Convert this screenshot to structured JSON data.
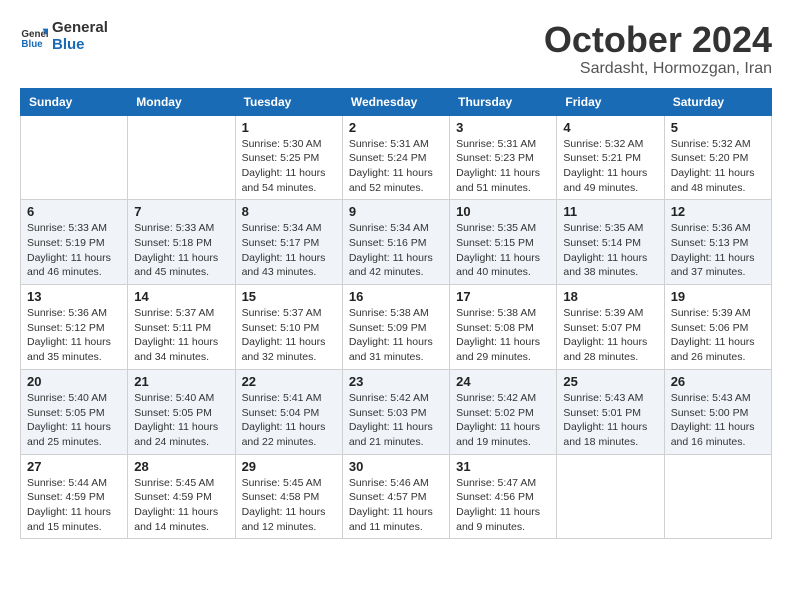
{
  "header": {
    "logo_line1": "General",
    "logo_line2": "Blue",
    "month": "October 2024",
    "location": "Sardasht, Hormozgan, Iran"
  },
  "weekdays": [
    "Sunday",
    "Monday",
    "Tuesday",
    "Wednesday",
    "Thursday",
    "Friday",
    "Saturday"
  ],
  "weeks": [
    [
      {
        "day": "",
        "sunrise": "",
        "sunset": "",
        "daylight": ""
      },
      {
        "day": "",
        "sunrise": "",
        "sunset": "",
        "daylight": ""
      },
      {
        "day": "1",
        "sunrise": "Sunrise: 5:30 AM",
        "sunset": "Sunset: 5:25 PM",
        "daylight": "Daylight: 11 hours and 54 minutes."
      },
      {
        "day": "2",
        "sunrise": "Sunrise: 5:31 AM",
        "sunset": "Sunset: 5:24 PM",
        "daylight": "Daylight: 11 hours and 52 minutes."
      },
      {
        "day": "3",
        "sunrise": "Sunrise: 5:31 AM",
        "sunset": "Sunset: 5:23 PM",
        "daylight": "Daylight: 11 hours and 51 minutes."
      },
      {
        "day": "4",
        "sunrise": "Sunrise: 5:32 AM",
        "sunset": "Sunset: 5:21 PM",
        "daylight": "Daylight: 11 hours and 49 minutes."
      },
      {
        "day": "5",
        "sunrise": "Sunrise: 5:32 AM",
        "sunset": "Sunset: 5:20 PM",
        "daylight": "Daylight: 11 hours and 48 minutes."
      }
    ],
    [
      {
        "day": "6",
        "sunrise": "Sunrise: 5:33 AM",
        "sunset": "Sunset: 5:19 PM",
        "daylight": "Daylight: 11 hours and 46 minutes."
      },
      {
        "day": "7",
        "sunrise": "Sunrise: 5:33 AM",
        "sunset": "Sunset: 5:18 PM",
        "daylight": "Daylight: 11 hours and 45 minutes."
      },
      {
        "day": "8",
        "sunrise": "Sunrise: 5:34 AM",
        "sunset": "Sunset: 5:17 PM",
        "daylight": "Daylight: 11 hours and 43 minutes."
      },
      {
        "day": "9",
        "sunrise": "Sunrise: 5:34 AM",
        "sunset": "Sunset: 5:16 PM",
        "daylight": "Daylight: 11 hours and 42 minutes."
      },
      {
        "day": "10",
        "sunrise": "Sunrise: 5:35 AM",
        "sunset": "Sunset: 5:15 PM",
        "daylight": "Daylight: 11 hours and 40 minutes."
      },
      {
        "day": "11",
        "sunrise": "Sunrise: 5:35 AM",
        "sunset": "Sunset: 5:14 PM",
        "daylight": "Daylight: 11 hours and 38 minutes."
      },
      {
        "day": "12",
        "sunrise": "Sunrise: 5:36 AM",
        "sunset": "Sunset: 5:13 PM",
        "daylight": "Daylight: 11 hours and 37 minutes."
      }
    ],
    [
      {
        "day": "13",
        "sunrise": "Sunrise: 5:36 AM",
        "sunset": "Sunset: 5:12 PM",
        "daylight": "Daylight: 11 hours and 35 minutes."
      },
      {
        "day": "14",
        "sunrise": "Sunrise: 5:37 AM",
        "sunset": "Sunset: 5:11 PM",
        "daylight": "Daylight: 11 hours and 34 minutes."
      },
      {
        "day": "15",
        "sunrise": "Sunrise: 5:37 AM",
        "sunset": "Sunset: 5:10 PM",
        "daylight": "Daylight: 11 hours and 32 minutes."
      },
      {
        "day": "16",
        "sunrise": "Sunrise: 5:38 AM",
        "sunset": "Sunset: 5:09 PM",
        "daylight": "Daylight: 11 hours and 31 minutes."
      },
      {
        "day": "17",
        "sunrise": "Sunrise: 5:38 AM",
        "sunset": "Sunset: 5:08 PM",
        "daylight": "Daylight: 11 hours and 29 minutes."
      },
      {
        "day": "18",
        "sunrise": "Sunrise: 5:39 AM",
        "sunset": "Sunset: 5:07 PM",
        "daylight": "Daylight: 11 hours and 28 minutes."
      },
      {
        "day": "19",
        "sunrise": "Sunrise: 5:39 AM",
        "sunset": "Sunset: 5:06 PM",
        "daylight": "Daylight: 11 hours and 26 minutes."
      }
    ],
    [
      {
        "day": "20",
        "sunrise": "Sunrise: 5:40 AM",
        "sunset": "Sunset: 5:05 PM",
        "daylight": "Daylight: 11 hours and 25 minutes."
      },
      {
        "day": "21",
        "sunrise": "Sunrise: 5:40 AM",
        "sunset": "Sunset: 5:05 PM",
        "daylight": "Daylight: 11 hours and 24 minutes."
      },
      {
        "day": "22",
        "sunrise": "Sunrise: 5:41 AM",
        "sunset": "Sunset: 5:04 PM",
        "daylight": "Daylight: 11 hours and 22 minutes."
      },
      {
        "day": "23",
        "sunrise": "Sunrise: 5:42 AM",
        "sunset": "Sunset: 5:03 PM",
        "daylight": "Daylight: 11 hours and 21 minutes."
      },
      {
        "day": "24",
        "sunrise": "Sunrise: 5:42 AM",
        "sunset": "Sunset: 5:02 PM",
        "daylight": "Daylight: 11 hours and 19 minutes."
      },
      {
        "day": "25",
        "sunrise": "Sunrise: 5:43 AM",
        "sunset": "Sunset: 5:01 PM",
        "daylight": "Daylight: 11 hours and 18 minutes."
      },
      {
        "day": "26",
        "sunrise": "Sunrise: 5:43 AM",
        "sunset": "Sunset: 5:00 PM",
        "daylight": "Daylight: 11 hours and 16 minutes."
      }
    ],
    [
      {
        "day": "27",
        "sunrise": "Sunrise: 5:44 AM",
        "sunset": "Sunset: 4:59 PM",
        "daylight": "Daylight: 11 hours and 15 minutes."
      },
      {
        "day": "28",
        "sunrise": "Sunrise: 5:45 AM",
        "sunset": "Sunset: 4:59 PM",
        "daylight": "Daylight: 11 hours and 14 minutes."
      },
      {
        "day": "29",
        "sunrise": "Sunrise: 5:45 AM",
        "sunset": "Sunset: 4:58 PM",
        "daylight": "Daylight: 11 hours and 12 minutes."
      },
      {
        "day": "30",
        "sunrise": "Sunrise: 5:46 AM",
        "sunset": "Sunset: 4:57 PM",
        "daylight": "Daylight: 11 hours and 11 minutes."
      },
      {
        "day": "31",
        "sunrise": "Sunrise: 5:47 AM",
        "sunset": "Sunset: 4:56 PM",
        "daylight": "Daylight: 11 hours and 9 minutes."
      },
      {
        "day": "",
        "sunrise": "",
        "sunset": "",
        "daylight": ""
      },
      {
        "day": "",
        "sunrise": "",
        "sunset": "",
        "daylight": ""
      }
    ]
  ]
}
